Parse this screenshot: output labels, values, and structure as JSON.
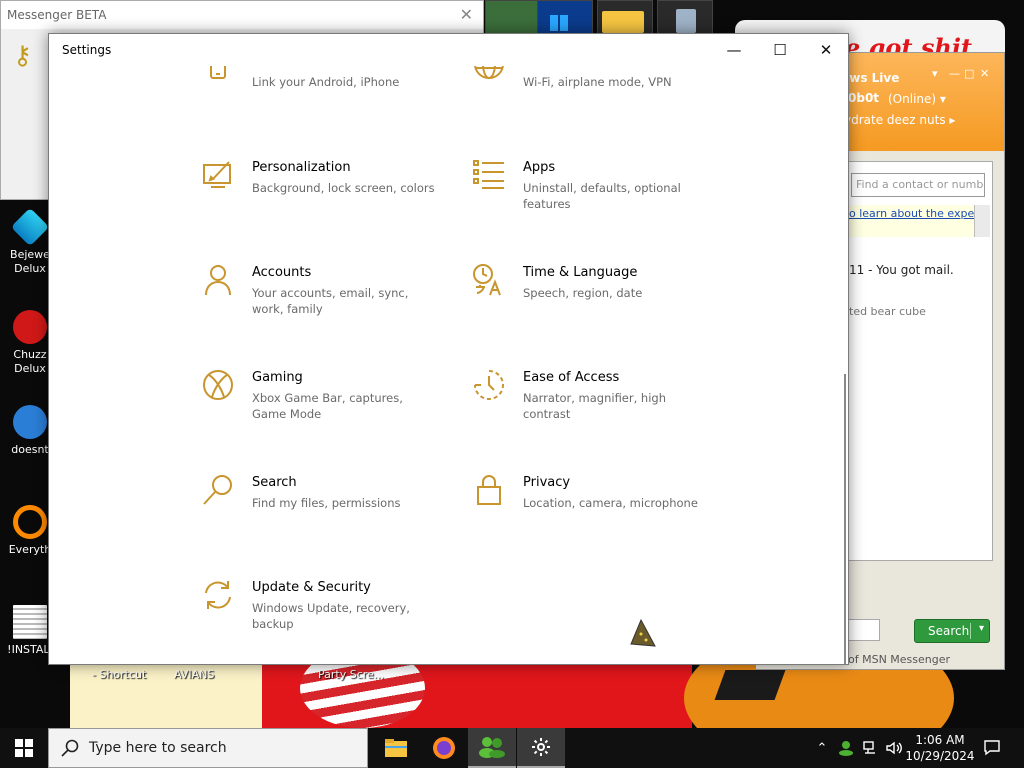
{
  "desktop": {
    "graffiti": "e got shit",
    "icons": [
      {
        "label": "Bejewe Delux"
      },
      {
        "label": "Chuzz Delux"
      },
      {
        "label": "doesnt"
      },
      {
        "label": "Everyth"
      },
      {
        "label": "!INSTALI"
      }
    ],
    "bottom_labels": [
      "- Shortcut",
      "AVIANS",
      "Party Scre..."
    ]
  },
  "messenger_beta": {
    "title": "Messenger BETA",
    "close": "✕"
  },
  "msn": {
    "title": "ows Live",
    "controls": [
      "▾",
      "—",
      "□",
      "✕"
    ],
    "name": "0b0t",
    "status": "(Online) ▾",
    "personal_message": "ydrate deez nuts ▸",
    "find_placeholder": "Find a contact or numbe",
    "info_text": "o learn about the experience",
    "mail_text": "11 - You got mail.",
    "bear_text": "ted bear cube",
    "search_button": "Search",
    "footer": "of MSN Messenger",
    "colors": {
      "header": "#f7a534",
      "search": "#2e9a3d"
    }
  },
  "settings": {
    "title": "Settings",
    "controls": {
      "minimize": "—",
      "maximize": "☐",
      "close": "✕"
    },
    "accent_color": "#c8952e",
    "tiles": [
      {
        "title": "",
        "desc": "Link your Android, iPhone",
        "icon": "phone-icon"
      },
      {
        "title": "",
        "desc": "Wi-Fi, airplane mode, VPN",
        "icon": "globe-icon"
      },
      {
        "title": "Personalization",
        "desc": "Background, lock screen, colors",
        "icon": "personalization-icon"
      },
      {
        "title": "Apps",
        "desc": "Uninstall, defaults, optional features",
        "icon": "apps-icon"
      },
      {
        "title": "Accounts",
        "desc": "Your accounts, email, sync, work, family",
        "icon": "person-icon"
      },
      {
        "title": "Time & Language",
        "desc": "Speech, region, date",
        "icon": "time-language-icon"
      },
      {
        "title": "Gaming",
        "desc": "Xbox Game Bar, captures, Game Mode",
        "icon": "xbox-icon"
      },
      {
        "title": "Ease of Access",
        "desc": "Narrator, magnifier, high contrast",
        "icon": "ease-of-access-icon"
      },
      {
        "title": "Search",
        "desc": "Find my files, permissions",
        "icon": "search-icon"
      },
      {
        "title": "Privacy",
        "desc": "Location, camera, microphone",
        "icon": "lock-icon"
      },
      {
        "title": "Update & Security",
        "desc": "Windows Update, recovery, backup",
        "icon": "update-icon"
      }
    ]
  },
  "taskbar": {
    "search_placeholder": "Type here to search",
    "time": "1:06 AM",
    "date": "10/29/2024",
    "apps": [
      "file-explorer-icon",
      "firefox-icon",
      "msn-messenger-icon",
      "settings-gear-icon"
    ]
  }
}
